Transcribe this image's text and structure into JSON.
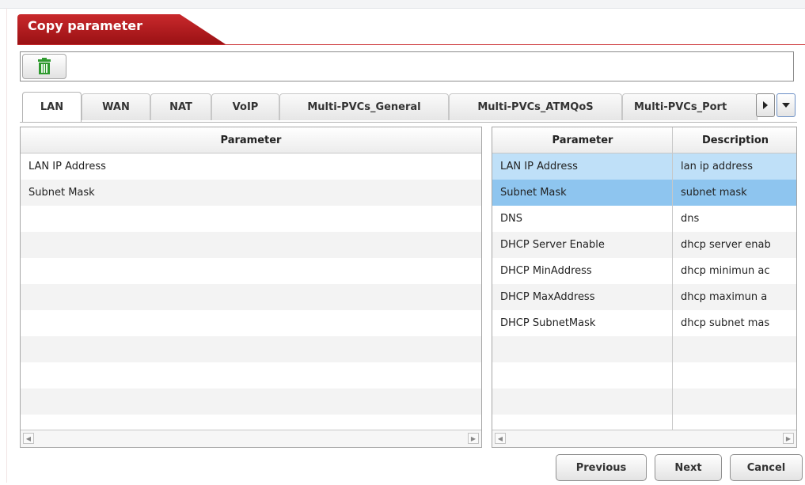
{
  "header": {
    "title": "Copy parameter"
  },
  "toolbar": {
    "delete_icon": "trash-icon",
    "delete_color": "#2e9a2e"
  },
  "tabs": [
    {
      "label": "LAN",
      "active": true
    },
    {
      "label": "WAN",
      "active": false
    },
    {
      "label": "NAT",
      "active": false
    },
    {
      "label": "VoIP",
      "active": false
    },
    {
      "label": "Multi-PVCs_General",
      "active": false
    },
    {
      "label": "Multi-PVCs_ATMQoS",
      "active": false
    },
    {
      "label": "Multi-PVCs_Port",
      "active": false
    }
  ],
  "left_grid": {
    "header": "Parameter",
    "rows": [
      "LAN IP Address",
      "Subnet Mask"
    ]
  },
  "right_grid": {
    "headers": [
      "Parameter",
      "Description"
    ],
    "rows": [
      {
        "parameter": "LAN IP Address",
        "description": "lan ip address"
      },
      {
        "parameter": "Subnet Mask",
        "description": "subnet mask"
      },
      {
        "parameter": "DNS",
        "description": "dns"
      },
      {
        "parameter": "DHCP Server Enable",
        "description": "dhcp server enab"
      },
      {
        "parameter": "DHCP MinAddress",
        "description": "dhcp minimun ac"
      },
      {
        "parameter": "DHCP MaxAddress",
        "description": "dhcp maximun a"
      },
      {
        "parameter": "DHCP SubnetMask",
        "description": "dhcp subnet mas"
      }
    ]
  },
  "buttons": {
    "previous": "Previous",
    "next": "Next",
    "cancel": "Cancel"
  },
  "colors": {
    "accent": "#b71c1f",
    "selected_row_1": "#bfe0f8",
    "selected_row_2": "#8ec5ef"
  }
}
